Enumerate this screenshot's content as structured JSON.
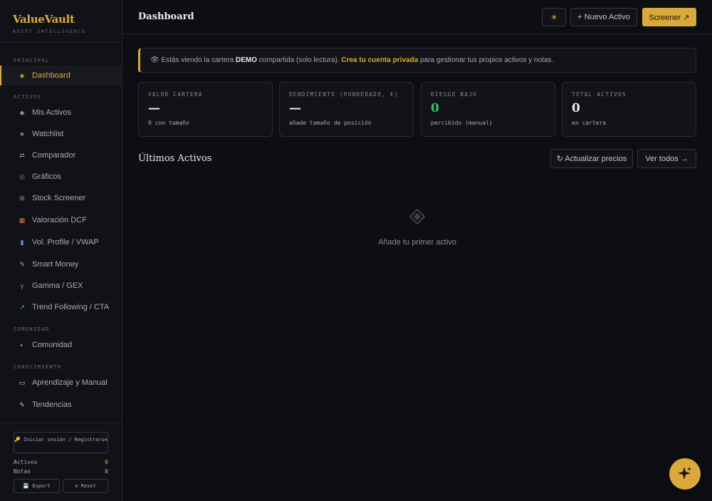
{
  "brand": {
    "title": "ValueVault",
    "subtitle": "ASSET INTELLIGENCE"
  },
  "sidebar": {
    "sections": {
      "principal": "PRINCIPAL",
      "activos": "ACTIVOS",
      "comunidad": "COMUNIDAD",
      "conocimiento": "CONOCIMIENTO"
    },
    "items": [
      {
        "label": "Dashboard",
        "icon": "◈"
      },
      {
        "label": "Mis Activos",
        "icon": "◆"
      },
      {
        "label": "Watchlist",
        "icon": "★"
      },
      {
        "label": "Comparador",
        "icon": "⇄"
      },
      {
        "label": "Gráficos",
        "icon": "◎"
      },
      {
        "label": "Stock Screener",
        "icon": "⊞"
      },
      {
        "label": "Valoración DCF",
        "icon": "▦"
      },
      {
        "label": "Vol. Profile / VWAP",
        "icon": "▮"
      },
      {
        "label": "Smart Money",
        "icon": "ϟ"
      },
      {
        "label": "Gamma / GEX",
        "icon": "γ"
      },
      {
        "label": "Trend Following / CTA",
        "icon": "↗"
      },
      {
        "label": "Comunidad",
        "icon": "◐"
      },
      {
        "label": "Aprendizaje y Manual",
        "icon": "▭"
      },
      {
        "label": "Tendencias",
        "icon": "✎"
      }
    ],
    "login": "🔑 Iniciar sesión / Registrarse",
    "stats": [
      {
        "label": "Activos",
        "value": "0"
      },
      {
        "label": "Notas",
        "value": "0"
      }
    ],
    "export_label": "💾 Export",
    "reset_label": "⊘ Reset"
  },
  "header": {
    "title": "Dashboard",
    "theme_icon": "☀",
    "new_asset": "+ Nuevo Activo",
    "screener": "Screener ↗"
  },
  "banner": {
    "icon": "👁",
    "pre": " Estás viendo la cartera ",
    "demo": "DEMO",
    "mid": " compartida (solo lectura). ",
    "link": "Crea tu cuenta privada",
    "post": " para gestionar tus propios activos y notas."
  },
  "cards": [
    {
      "label": "VALOR CARTERA",
      "value": "—",
      "sub": "0 con tamaño"
    },
    {
      "label": "RENDIMIENTO (PONDERADO, €)",
      "value": "—",
      "sub": "añade tamaño de posición"
    },
    {
      "label": "RIESGO BAJO",
      "value": "0",
      "sub": "percibido (manual)"
    },
    {
      "label": "TOTAL ACTIVOS",
      "value": "0",
      "sub": "en cartera"
    }
  ],
  "latest": {
    "title": "Últimos Activos",
    "refresh": "↻ Actualizar precios",
    "view_all": "Ver todos →",
    "empty": "Añade tu primer activo"
  },
  "colors": {
    "accent": "#d9a93b",
    "positive": "#2fc46a",
    "background": "#0d0e12"
  }
}
